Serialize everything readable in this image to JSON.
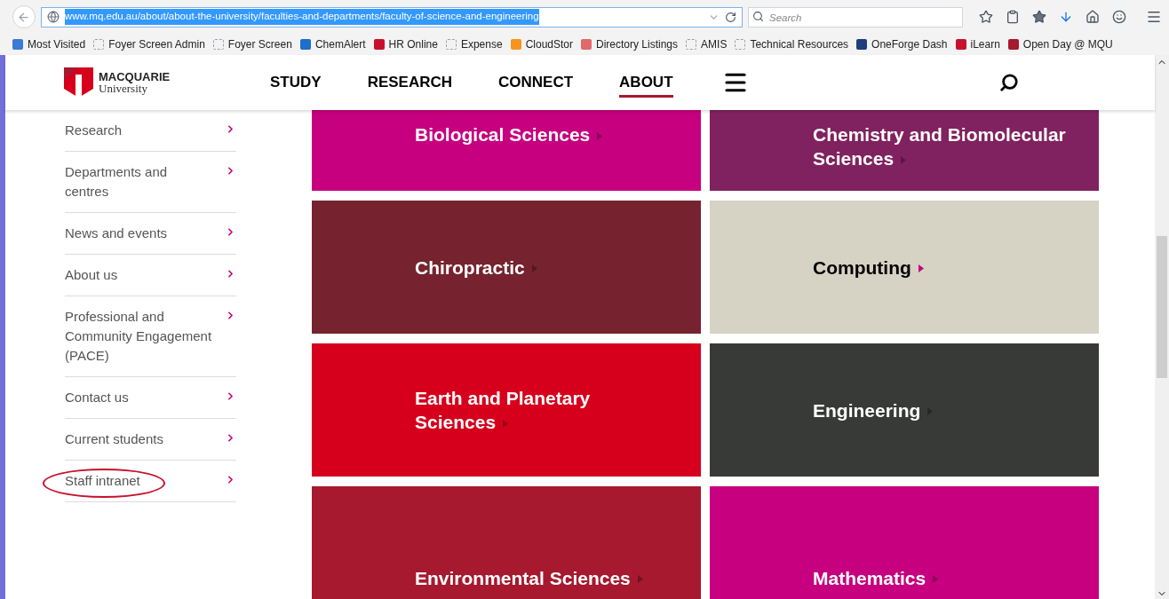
{
  "browser": {
    "url": "www.mq.edu.au/about/about-the-university/faculties-and-departments/faculty-of-science-and-engineering",
    "search": {
      "placeholder": "Search"
    },
    "bookmarks": [
      {
        "label": "Most Visited",
        "kind": "app",
        "color": "#3a7bd5"
      },
      {
        "label": "Foyer Screen Admin",
        "kind": "blank"
      },
      {
        "label": "Foyer Screen",
        "kind": "blank"
      },
      {
        "label": "ChemAlert",
        "kind": "app",
        "color": "#1d6fc9"
      },
      {
        "label": "HR Online",
        "kind": "app",
        "color": "#c8102e"
      },
      {
        "label": "Expense",
        "kind": "blank"
      },
      {
        "label": "CloudStor",
        "kind": "app",
        "color": "#f7941d"
      },
      {
        "label": "Directory Listings",
        "kind": "app",
        "color": "#e06a6a"
      },
      {
        "label": "AMIS",
        "kind": "blank"
      },
      {
        "label": "Technical Resources",
        "kind": "blank"
      },
      {
        "label": "OneForge Dash",
        "kind": "app",
        "color": "#1d3f7a"
      },
      {
        "label": "iLearn",
        "kind": "app",
        "color": "#c8102e"
      },
      {
        "label": "Open Day @ MQU",
        "kind": "app",
        "color": "#a6192e"
      }
    ]
  },
  "header": {
    "logo": {
      "name": "MACQUARIE",
      "sub": "University"
    },
    "nav": [
      {
        "label": "STUDY",
        "selected": false
      },
      {
        "label": "RESEARCH",
        "selected": false
      },
      {
        "label": "CONNECT",
        "selected": false
      },
      {
        "label": "ABOUT",
        "selected": true
      }
    ]
  },
  "sidebar": {
    "items": [
      {
        "label": "Research",
        "circled": false
      },
      {
        "label": "Departments and centres",
        "circled": false
      },
      {
        "label": "News and events",
        "circled": false
      },
      {
        "label": "About us",
        "circled": false
      },
      {
        "label": "Professional and Community Engagement (PACE)",
        "circled": false
      },
      {
        "label": "Contact us",
        "circled": false
      },
      {
        "label": "Current students",
        "circled": false
      },
      {
        "label": "Staff intranet",
        "circled": true
      }
    ]
  },
  "tiles": [
    {
      "title": "Biological Sciences",
      "color": "#c6007e",
      "kind": "light"
    },
    {
      "title": "Chemistry and Biomolecular Sciences",
      "color": "#80225f",
      "kind": "light"
    },
    {
      "title": "Chiropractic",
      "color": "#76232f",
      "kind": "light"
    },
    {
      "title": "Computing",
      "color": "#d6d2c4",
      "kind": "dark"
    },
    {
      "title": "Earth and Planetary Sciences",
      "color": "#d6001c",
      "kind": "light"
    },
    {
      "title": "Engineering",
      "color": "#373a36",
      "kind": "light"
    },
    {
      "title": "Environmental Sciences",
      "color": "#a6192e",
      "kind": "light"
    },
    {
      "title": "Mathematics",
      "color": "#c6007e",
      "kind": "light"
    }
  ]
}
